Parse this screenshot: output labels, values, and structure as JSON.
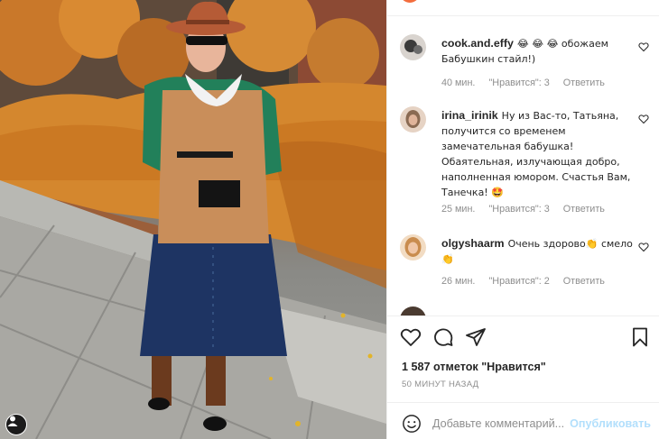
{
  "comments": [
    {
      "username": "cook.and.effy",
      "text": "😂 😂 😂 обожаем Бабушкин стайл!)",
      "time": "40 мин.",
      "likes": "\"Нравится\": 3",
      "reply": "Ответить",
      "avatar_color": "#3b3b3b"
    },
    {
      "username": "irina_irinik",
      "text": "Ну из Вас-то, Татьяна, получится со временем замечательная бабушка! Обаятельная, излучающая добро, наполненная юмором. Счастья Вам, Танечка! 🤩",
      "time": "25 мин.",
      "likes": "\"Нравится\": 3",
      "reply": "Ответить",
      "avatar_color": "#8a6a52"
    },
    {
      "username": "olgyshaarm",
      "text": "Очень здорово👏 смело👏",
      "time": "26 мин.",
      "likes": "\"Нравится\": 2",
      "reply": "Ответить",
      "avatar_color": "#c98c4e"
    }
  ],
  "icons": {
    "like": "heart-icon",
    "comment": "comment-icon",
    "share": "share-icon",
    "save": "bookmark-icon",
    "emoji": "emoji-icon",
    "user": "user-icon"
  },
  "post": {
    "likes": "1 587 отметок \"Нравится\"",
    "time": "50 МИНУТ НАЗАД"
  },
  "comment_box": {
    "placeholder": "Добавьте комментарий...",
    "publish": "Опубликовать"
  },
  "colors": {
    "accent": "#0095f6",
    "publish_disabled": "#b2dffc",
    "muted": "#8e8e8e"
  }
}
